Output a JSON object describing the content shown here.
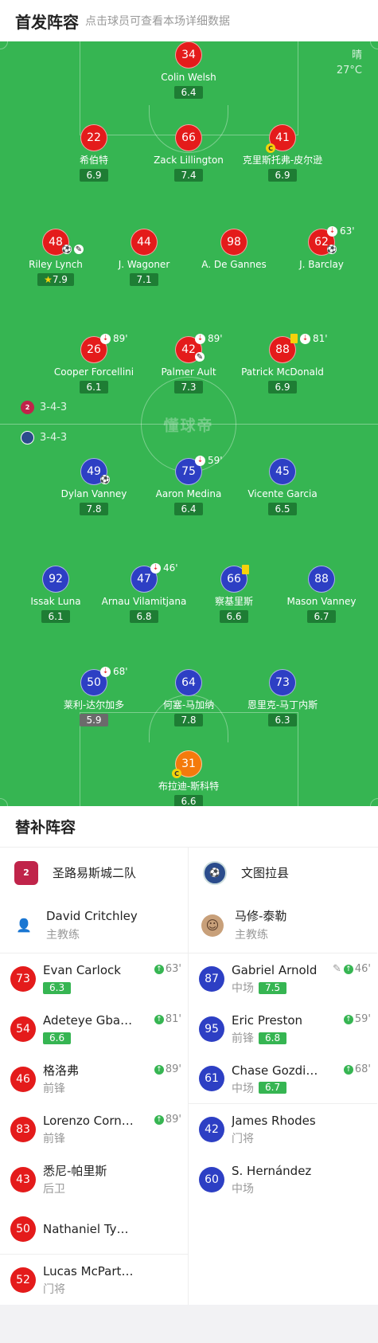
{
  "header": {
    "title": "首发阵容",
    "hint": "点击球员可查看本场详细数据"
  },
  "weather": {
    "condition": "晴",
    "temperature": "27°C"
  },
  "watermark": "懂球帝",
  "home": {
    "formation": "3-4-3",
    "logo_text": "2",
    "players": [
      {
        "num": "34",
        "name": "Colin Welsh",
        "rating": "6.4"
      },
      {
        "num": "22",
        "name": "希伯特",
        "rating": "6.9"
      },
      {
        "num": "66",
        "name": "Zack Lillington",
        "rating": "7.4"
      },
      {
        "num": "41",
        "name": "克里斯托弗-皮尔逊",
        "rating": "6.9",
        "captain": "C"
      },
      {
        "num": "48",
        "name": "Riley Lynch",
        "rating": "7.9"
      },
      {
        "num": "44",
        "name": "J. Wagoner",
        "rating": "7.1"
      },
      {
        "num": "98",
        "name": "A. De Gannes",
        "rating": ""
      },
      {
        "num": "62",
        "name": "J. Barclay",
        "rating": "",
        "sub_time": "63'"
      },
      {
        "num": "26",
        "name": "Cooper Forcellini",
        "rating": "6.1",
        "sub_time": "89'"
      },
      {
        "num": "42",
        "name": "Palmer Ault",
        "rating": "7.3",
        "sub_time": "89'"
      },
      {
        "num": "88",
        "name": "Patrick McDonald",
        "rating": "6.9",
        "sub_time": "81'"
      }
    ]
  },
  "away": {
    "formation": "3-4-3",
    "players": [
      {
        "num": "49",
        "name": "Dylan Vanney",
        "rating": "7.8"
      },
      {
        "num": "75",
        "name": "Aaron Medina",
        "rating": "6.4",
        "sub_time": "59'"
      },
      {
        "num": "45",
        "name": "Vicente Garcia",
        "rating": "6.5"
      },
      {
        "num": "92",
        "name": "Issak Luna",
        "rating": "6.1"
      },
      {
        "num": "47",
        "name": "Arnau Vilamitjana",
        "rating": "6.8",
        "sub_time": "46'"
      },
      {
        "num": "66",
        "name": "察基里斯",
        "rating": "6.6"
      },
      {
        "num": "88",
        "name": "Mason Vanney",
        "rating": "6.7"
      },
      {
        "num": "50",
        "name": "莱利-达尔加多",
        "rating": "5.9",
        "sub_time": "68'"
      },
      {
        "num": "64",
        "name": "何塞-马加纳",
        "rating": "7.8"
      },
      {
        "num": "73",
        "name": "恩里克-马丁内斯",
        "rating": "6.3"
      },
      {
        "num": "31",
        "name": "布拉迪-斯科特",
        "rating": "6.6",
        "captain": "C"
      }
    ]
  },
  "subs": {
    "title": "替补阵容",
    "home": {
      "team_name": "圣路易斯城二队",
      "coach": {
        "name": "David Critchley",
        "role": "主教练"
      },
      "players": [
        {
          "num": "73",
          "name": "Evan Carlock",
          "pos": "",
          "rating": "6.3",
          "time": "63'"
        },
        {
          "num": "54",
          "name": "Adeteye Gba…",
          "pos": "",
          "rating": "6.6",
          "time": "81'"
        },
        {
          "num": "46",
          "name": "格洛弗",
          "pos": "前锋",
          "rating": "",
          "time": "89'"
        },
        {
          "num": "83",
          "name": "Lorenzo Corn…",
          "pos": "前锋",
          "rating": "",
          "time": "89'"
        },
        {
          "num": "43",
          "name": "悉尼-帕里斯",
          "pos": "后卫",
          "rating": "",
          "time": ""
        },
        {
          "num": "50",
          "name": "Nathaniel Tyn…",
          "pos": "",
          "rating": "",
          "time": ""
        },
        {
          "num": "52",
          "name": "Lucas McPartlin",
          "pos": "门将",
          "rating": "",
          "time": ""
        }
      ]
    },
    "away": {
      "team_name": "文图拉县",
      "coach": {
        "name": "马修-泰勒",
        "role": "主教练"
      },
      "players": [
        {
          "num": "87",
          "name": "Gabriel Arnold",
          "pos": "中场",
          "rating": "7.5",
          "time": "46'"
        },
        {
          "num": "95",
          "name": "Eric Preston",
          "pos": "前锋",
          "rating": "6.8",
          "time": "59'"
        },
        {
          "num": "61",
          "name": "Chase Gozdi…",
          "pos": "中场",
          "rating": "6.7",
          "time": "68'"
        },
        {
          "num": "42",
          "name": "James Rhodes",
          "pos": "门将",
          "rating": "",
          "time": ""
        },
        {
          "num": "60",
          "name": "S. Hernández",
          "pos": "中场",
          "rating": "",
          "time": ""
        }
      ]
    }
  },
  "colors": {
    "pitch": "#36b552",
    "home": "#e41b1b",
    "away": "#2d3fc4",
    "away_gk": "#f47a0c",
    "rating_bg": "#1e7d34"
  }
}
